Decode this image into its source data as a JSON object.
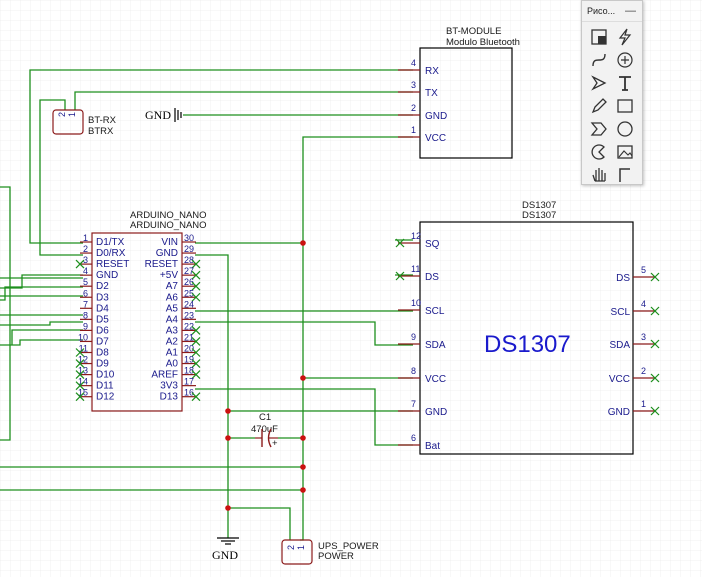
{
  "bt_module": {
    "title": "BT-MODULE",
    "subtitle": "Modulo Bluetooth",
    "pins": [
      {
        "num": "4",
        "name": "RX"
      },
      {
        "num": "3",
        "name": "TX"
      },
      {
        "num": "2",
        "name": "GND"
      },
      {
        "num": "1",
        "name": "VCC"
      }
    ]
  },
  "btrx": {
    "pin2": "2",
    "pin1": "1",
    "label1": "BT-RX",
    "label2": "BTRX"
  },
  "gnd_top": {
    "label": "GND"
  },
  "gnd_bottom": {
    "label": "GND"
  },
  "nano": {
    "title1": "ARDUINO_NANO",
    "title2": "ARDUINO_NANO",
    "left_pins": [
      {
        "num": "1",
        "name": "D1/TX"
      },
      {
        "num": "2",
        "name": "D0/RX"
      },
      {
        "num": "3",
        "name": "RESET"
      },
      {
        "num": "4",
        "name": "GND"
      },
      {
        "num": "5",
        "name": "D2"
      },
      {
        "num": "6",
        "name": "D3"
      },
      {
        "num": "7",
        "name": "D4"
      },
      {
        "num": "8",
        "name": "D5"
      },
      {
        "num": "9",
        "name": "D6"
      },
      {
        "num": "10",
        "name": "D7"
      },
      {
        "num": "11",
        "name": "D8"
      },
      {
        "num": "12",
        "name": "D9"
      },
      {
        "num": "13",
        "name": "D10"
      },
      {
        "num": "14",
        "name": "D11"
      },
      {
        "num": "15",
        "name": "D12"
      }
    ],
    "right_pins": [
      {
        "num": "30",
        "name": "VIN"
      },
      {
        "num": "29",
        "name": "GND"
      },
      {
        "num": "28",
        "name": "RESET"
      },
      {
        "num": "27",
        "name": "+5V"
      },
      {
        "num": "26",
        "name": "A7"
      },
      {
        "num": "25",
        "name": "A6"
      },
      {
        "num": "24",
        "name": "A5"
      },
      {
        "num": "23",
        "name": "A4"
      },
      {
        "num": "22",
        "name": "A3"
      },
      {
        "num": "21",
        "name": "A2"
      },
      {
        "num": "20",
        "name": "A1"
      },
      {
        "num": "19",
        "name": "A0"
      },
      {
        "num": "18",
        "name": "AREF"
      },
      {
        "num": "17",
        "name": "3V3"
      },
      {
        "num": "16",
        "name": "D13"
      }
    ]
  },
  "ds1307": {
    "title1": "DS1307",
    "title2": "DS1307",
    "big": "DS1307",
    "left_pins": [
      {
        "num": "12",
        "name": "SQ"
      },
      {
        "num": "11",
        "name": "DS"
      },
      {
        "num": "10",
        "name": "SCL"
      },
      {
        "num": "9",
        "name": "SDA"
      },
      {
        "num": "8",
        "name": "VCC"
      },
      {
        "num": "7",
        "name": "GND"
      },
      {
        "num": "6",
        "name": "Bat"
      }
    ],
    "right_pins": [
      {
        "num": "5",
        "name": "DS"
      },
      {
        "num": "4",
        "name": "SCL"
      },
      {
        "num": "3",
        "name": "SDA"
      },
      {
        "num": "2",
        "name": "VCC"
      },
      {
        "num": "1",
        "name": "GND"
      }
    ]
  },
  "c1": {
    "name": "C1",
    "value": "470uF",
    "plus": "+"
  },
  "ups": {
    "pin2": "2",
    "pin1": "1",
    "label1": "UPS_POWER",
    "label2": "POWER"
  },
  "palette": {
    "title": "Рисо...",
    "minimize": "—",
    "tools": [
      "frame-tool-icon",
      "lightning-icon",
      "curve-icon",
      "circle-plus-icon",
      "arrow-icon",
      "text-tool-icon",
      "pencil-icon",
      "rectangle-icon",
      "chevron-shape-icon",
      "circle-icon",
      "pie-shape-icon",
      "image-icon",
      "hand-icon",
      "corner-icon"
    ]
  }
}
